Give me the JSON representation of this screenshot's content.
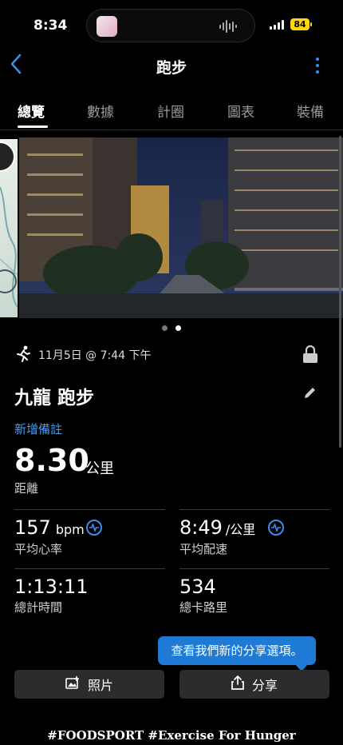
{
  "status_bar": {
    "time": "8:34",
    "battery": "84"
  },
  "nav": {
    "title": "跑步"
  },
  "tabs": [
    {
      "label": "總覽",
      "active": true
    },
    {
      "label": "數據"
    },
    {
      "label": "計圈"
    },
    {
      "label": "圖表"
    },
    {
      "label": "裝備"
    }
  ],
  "carousel": {
    "page_count": 2,
    "current_page": 2
  },
  "activity": {
    "date_time": "11月5日 @ 7:44 下午",
    "name": "九龍 跑步",
    "add_note": "新增備註",
    "distance": {
      "value": "8.30",
      "unit": "公里",
      "label": "距離"
    },
    "stats": {
      "heart_rate": {
        "value": "157",
        "unit": "bpm",
        "label": "平均心率"
      },
      "pace": {
        "value": "8:49",
        "unit": "/公里",
        "label": "平均配速"
      },
      "time": {
        "value": "1:13:11",
        "label": "總計時間"
      },
      "calories": {
        "value": "534",
        "label": "總卡路里"
      }
    }
  },
  "tooltip": "查看我們新的分享選項。",
  "buttons": {
    "photo": "照片",
    "share": "分享"
  },
  "footer": "#FOODSPORT #Exercise For Hunger",
  "colors": {
    "accent": "#3a8ee6",
    "tooltip": "#1f7ad6",
    "battery": "#ffd60a"
  }
}
